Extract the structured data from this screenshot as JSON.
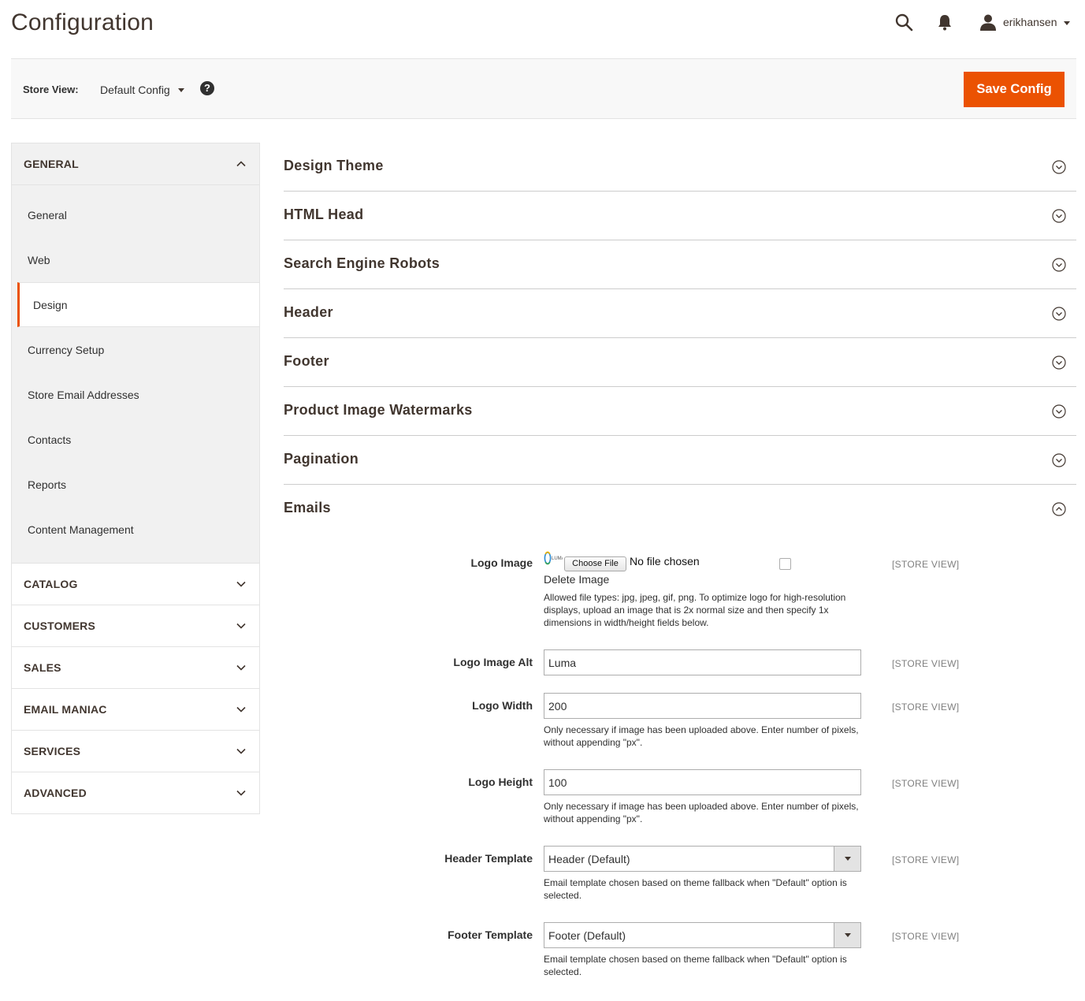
{
  "header": {
    "title": "Configuration",
    "username": "erikhansen"
  },
  "actions": {
    "store_view_label": "Store View:",
    "store_view_value": "Default Config",
    "help": "?",
    "save_label": "Save Config",
    "accent_color": "#eb5202"
  },
  "sidebar": {
    "general": {
      "title": "GENERAL",
      "items": [
        "General",
        "Web",
        "Design",
        "Currency Setup",
        "Store Email Addresses",
        "Contacts",
        "Reports",
        "Content Management"
      ],
      "active": "Design"
    },
    "groups": [
      "CATALOG",
      "CUSTOMERS",
      "SALES",
      "EMAIL MANIAC",
      "SERVICES",
      "ADVANCED"
    ]
  },
  "sections": [
    "Design Theme",
    "HTML Head",
    "Search Engine Robots",
    "Header",
    "Footer",
    "Product Image Watermarks",
    "Pagination",
    "Emails"
  ],
  "emails": {
    "scope": "[STORE VIEW]",
    "logo_image": {
      "label": "Logo Image",
      "choose_file": "Choose File",
      "no_file": "No file chosen",
      "delete_label": "Delete Image",
      "note": "Allowed file types: jpg, jpeg, gif, png. To optimize logo for high-resolution displays, upload an image that is 2x normal size and then specify 1x dimensions in width/height fields below."
    },
    "logo_alt": {
      "label": "Logo Image Alt",
      "value": "Luma"
    },
    "logo_width": {
      "label": "Logo Width",
      "value": "200",
      "note": "Only necessary if image has been uploaded above. Enter number of pixels, without appending \"px\"."
    },
    "logo_height": {
      "label": "Logo Height",
      "value": "100",
      "note": "Only necessary if image has been uploaded above. Enter number of pixels, without appending \"px\"."
    },
    "header_template": {
      "label": "Header Template",
      "value": "Header (Default)",
      "note": "Email template chosen based on theme fallback when \"Default\" option is selected."
    },
    "footer_template": {
      "label": "Footer Template",
      "value": "Footer (Default)",
      "note": "Email template chosen based on theme fallback when \"Default\" option is selected."
    }
  }
}
